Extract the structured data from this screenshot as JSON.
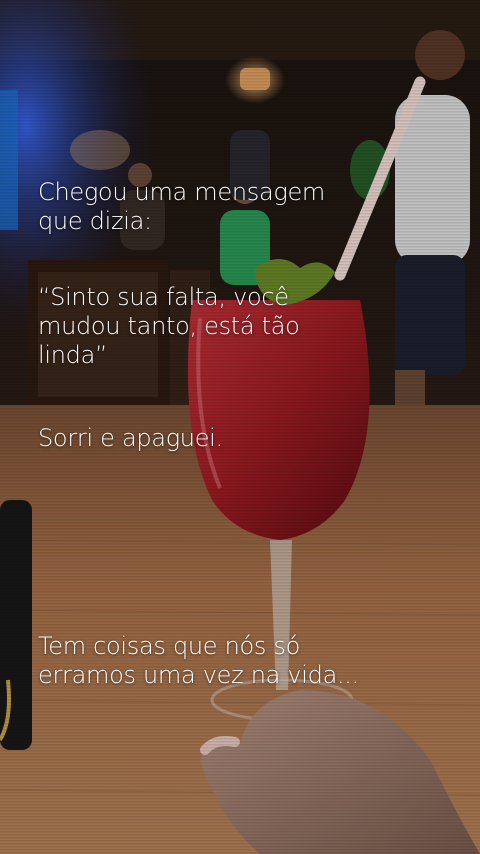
{
  "text": {
    "line1": "Chegou uma mensagem\nque dizia:",
    "quote": "“Sinto sua falta, você\nmudou tanto, está tão\nlinda”",
    "line3": "Sorri e apaguei.",
    "line4": "Tem coisas que nós só\nerramos uma vez na vida..."
  },
  "colors": {
    "text": "#ffffff",
    "drink": "#9c1c22",
    "table": "#a8714a",
    "background": "#120d0b"
  }
}
